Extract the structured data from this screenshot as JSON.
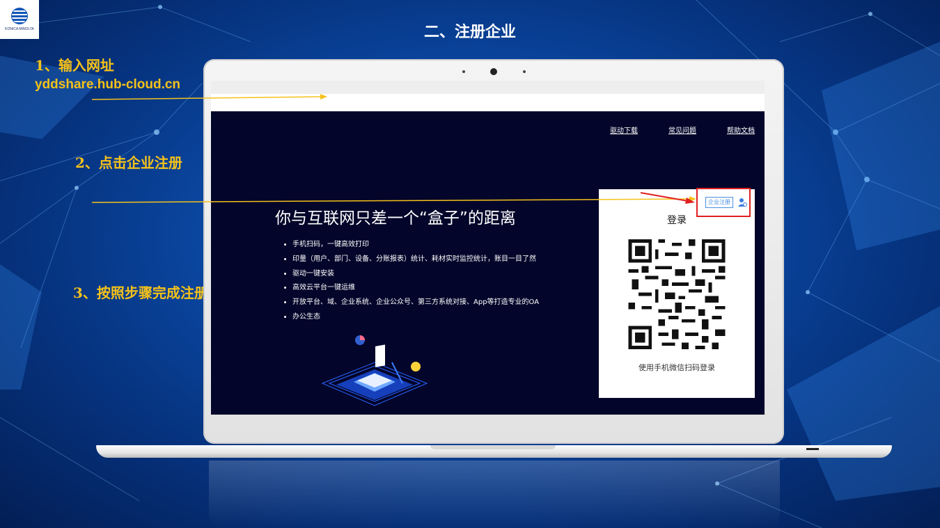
{
  "logo": {
    "text": "KONICA MINOLTA"
  },
  "slide": {
    "title": "二、注册企业",
    "steps": {
      "s1_label": "1、输入网址",
      "s1_url": "yddshare.hub-cloud.cn",
      "s2_label": "2、点击企业注册",
      "s3_label": "3、按照步骤完成注册"
    }
  },
  "site": {
    "nav": [
      "驱动下载",
      "常见问题",
      "帮助文档"
    ],
    "headline": "你与互联网只差一个“盒子”的距离",
    "features": [
      "手机扫码，一键高效打印",
      "印量（用户、部门、设备、分账报表）统计、耗材实时监控统计，账目一目了然",
      "驱动一键安装",
      "高效云平台一键运维",
      "开放平台、域、企业系统、企业公众号、第三方系统对接、App等打造专业的OA",
      "办公生态"
    ],
    "login": {
      "title": "登录",
      "hint": "使用手机微信扫码登录",
      "register_button": "企业注册"
    }
  },
  "colors": {
    "step_text": "#f5c21a",
    "screen_bg": "#03052a",
    "highlight_box": "#e02020",
    "register_accent": "#4a8fe0"
  }
}
